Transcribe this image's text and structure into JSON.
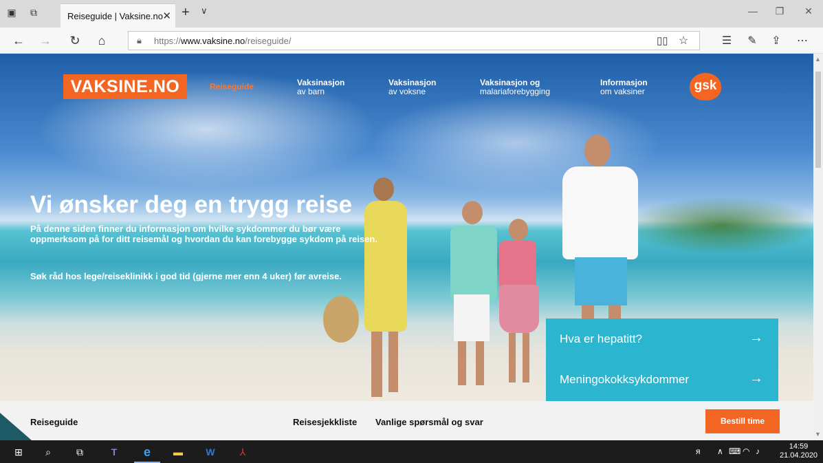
{
  "browser": {
    "tab_title": "Reiseguide | Vaksine.no",
    "url_prefix": "https://",
    "url_domain": "www.vaksine.no",
    "url_path": "/reiseguide/"
  },
  "site": {
    "logo": "VAKSINE.NO",
    "nav": [
      {
        "line1": "Reiseguide",
        "line2": ""
      },
      {
        "line1": "Vaksinasjon",
        "line2": "av barn"
      },
      {
        "line1": "Vaksinasjon",
        "line2": "av voksne"
      },
      {
        "line1": "Vaksinasjon og",
        "line2": "malariaforebygging"
      },
      {
        "line1": "Informasjon",
        "line2": "om vaksiner"
      }
    ],
    "partner_logo": "gsk"
  },
  "hero": {
    "title": "Vi ønsker deg en trygg reise",
    "intro": "På denne siden finner du informasjon om hvilke sykdommer du bør være oppmerksom på for ditt reisemål og hvordan du kan forebygge sykdom på reisen.",
    "advice": "Søk råd hos lege/reiseklinikk i god tid (gjerne mer enn 4 uker) før avreise."
  },
  "info_links": [
    {
      "label": "Hva er hepatitt?",
      "arrow": "→"
    },
    {
      "label": "Meningokokksykdommer",
      "arrow": "→"
    }
  ],
  "subnav": {
    "left": "Reiseguide",
    "links": [
      "Reisesjekkliste",
      "Vanlige spørsmål og svar"
    ],
    "book_button": "Bestill time"
  },
  "taskbar": {
    "time": "14:59",
    "date": "21.04.2020"
  },
  "colors": {
    "brand_orange": "#f26522",
    "info_cyan": "#2cb5cf",
    "subnav_bg": "#f2f2f2"
  }
}
